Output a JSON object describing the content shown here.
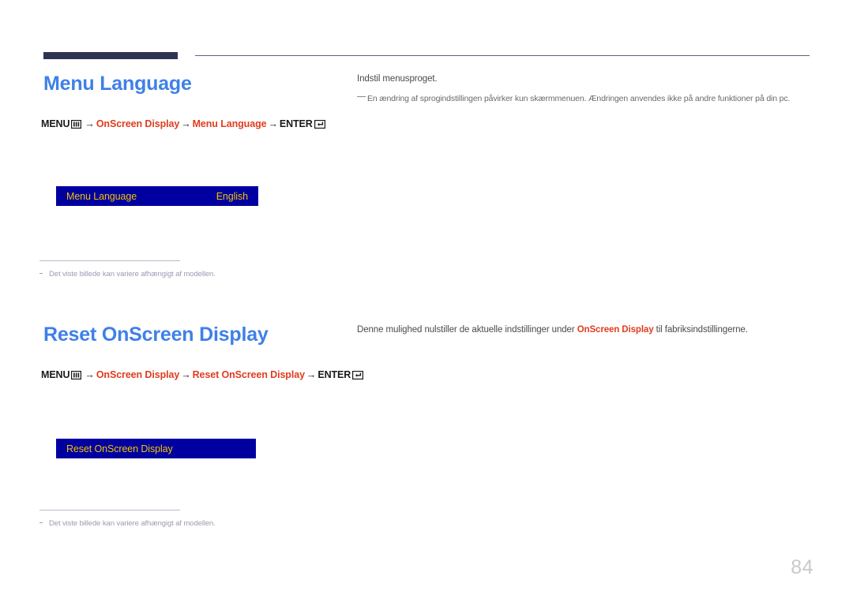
{
  "page": {
    "number": "84",
    "language": "da"
  },
  "sections": [
    {
      "heading": "Menu Language",
      "breadcrumb": {
        "menu_label": "MENU",
        "menu_icon": "menu-grid-icon",
        "arrow": "→",
        "step1": "OnScreen Display",
        "step2": "Menu Language",
        "enter_label": "ENTER",
        "enter_icon": "enter-return-icon"
      },
      "description": "Indstil menusproget.",
      "note": "En ændring af sprogindstillingen påvirker kun skærmmenuen. Ændringen anvendes ikke på andre funktioner på din pc.",
      "osd": {
        "label": "Menu Language",
        "value": "English",
        "bg_color": "#0000a0",
        "text_color": "#f2c200"
      },
      "footnote": "Det viste billede kan variere afhængigt af modellen."
    },
    {
      "heading": "Reset OnScreen Display",
      "breadcrumb": {
        "menu_label": "MENU",
        "menu_icon": "menu-grid-icon",
        "arrow": "→",
        "step1": "OnScreen Display",
        "step2": "Reset OnScreen Display",
        "enter_label": "ENTER",
        "enter_icon": "enter-return-icon"
      },
      "description_before": "Denne mulighed nulstiller de aktuelle indstillinger under ",
      "description_strong": "OnScreen Display",
      "description_after": " til fabriksindstillingerne.",
      "osd": {
        "label": "Reset OnScreen Display",
        "value": "",
        "bg_color": "#0000a0",
        "text_color": "#f2c200"
      },
      "footnote": "Det viste billede kan variere afhængigt af modellen."
    }
  ],
  "colors": {
    "heading_blue": "#3f80e8",
    "accent_red": "#e03c1e",
    "rule_navy": "#2e3452",
    "osd_blue": "#0000a0",
    "osd_gold": "#f2c200",
    "footnote_gray": "#9a9cb4",
    "pagenum_gray": "#c9c9c9"
  }
}
